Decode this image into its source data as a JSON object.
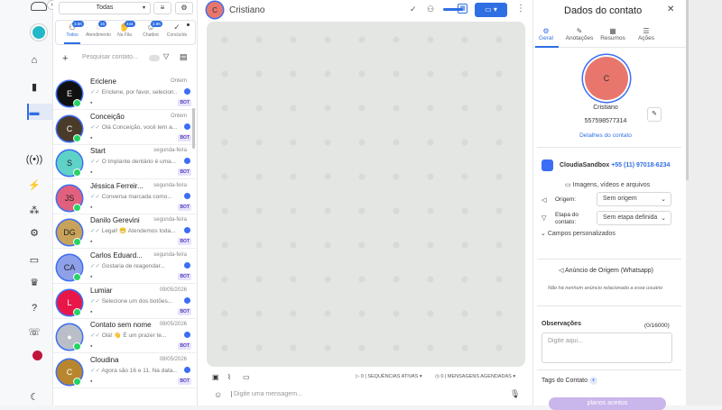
{
  "rail": {
    "items": [
      "home-icon",
      "chart-icon",
      "chat-icon",
      "broadcast-icon",
      "lightning-icon",
      "flow-icon",
      "gear-icon",
      "ticket-icon",
      "crown-icon",
      "help-icon",
      "support-icon",
      "record-icon",
      "moon-icon"
    ]
  },
  "list": {
    "filter_value": "Todas",
    "tabs": [
      {
        "label": "Todos",
        "badge": "3.5K"
      },
      {
        "label": "Atendimento",
        "badge": "16"
      },
      {
        "label": "Na Fila",
        "badge": "444"
      },
      {
        "label": "Chatbot",
        "badge": "2.8K"
      },
      {
        "label": "Concluído",
        "badge": ""
      }
    ],
    "search_placeholder": "Pesquisar contato...",
    "contacts": [
      {
        "initials": "E",
        "name": "Ericlene",
        "date": "Ontem",
        "msg": "Ericlene, por favor, selecion...",
        "color": "#111111",
        "text_color": "#ffffff",
        "bot": "BOT"
      },
      {
        "initials": "C",
        "name": "Conceição",
        "date": "Ontem",
        "msg": "Olá Conceição, você tem a...",
        "color": "#4a3a2a",
        "text_color": "#ffffff",
        "bot": "BOT"
      },
      {
        "initials": "S",
        "name": "Start",
        "date": "segunda-feira",
        "msg": "O Implante dentário é uma...",
        "color": "#5fd2c8",
        "text_color": "#222222",
        "bot": "BOT"
      },
      {
        "initials": "JS",
        "name": "Jéssica Ferreir...",
        "date": "segunda-feira",
        "msg": "Conversa marcada como...",
        "color": "#e0607e",
        "text_color": "#222222",
        "bot": "BOT"
      },
      {
        "initials": "DG",
        "name": "Danilo Gerevini",
        "date": "segunda-feira",
        "msg": "Legal! 😁 Atendemos toda...",
        "color": "#c9a25a",
        "text_color": "#222222",
        "bot": "BOT"
      },
      {
        "initials": "CA",
        "name": "Carlos Eduard...",
        "date": "segunda-feira",
        "msg": "Gostaria de reagendar...",
        "color": "#8ea0e8",
        "text_color": "#222222",
        "bot": "BOT"
      },
      {
        "initials": "L",
        "name": "Lumiar",
        "date": "09/05/2026",
        "msg": "Selecione um dos botões...",
        "color": "#e8174a",
        "text_color": "#ffffff",
        "bot": "BOT"
      },
      {
        "initials": "",
        "name": "Contato sem nome",
        "date": "08/05/2026",
        "msg": "Olá! 👋 É um prazer te...",
        "color": "#b9bec8",
        "text_color": "#ffffff",
        "bot": "BOT"
      },
      {
        "initials": "C",
        "name": "Cloudina",
        "date": "08/05/2026",
        "msg": "Agora são 16 e 11. Na data...",
        "color": "#b8862d",
        "text_color": "#ffffff",
        "bot": "BOT"
      }
    ]
  },
  "chat": {
    "contact_name": "Cristiano",
    "avatar_initial": "C",
    "sequences_count": "0",
    "sequences_label": "SEQUÊNCIAS ATIVAS",
    "scheduled_count": "0",
    "scheduled_label": "MENSAGENS AGENDADAS",
    "input_placeholder": "Digite uma mensagem..."
  },
  "panel": {
    "title": "Dados do contato",
    "tabs": [
      "Geral",
      "Anotações",
      "Resumos",
      "Ações"
    ],
    "avatar_initial": "C",
    "name": "Cristiano",
    "phone": "557598577314",
    "details_link": "Detalhes do contato",
    "channel_name": "CloudiaSandbox",
    "channel_phone": "+55 (11) 97018-6234",
    "media_label": "Imagens, vídeos e arquivos",
    "origin_label": "Origem:",
    "origin_value": "Sem origem",
    "stage_label": "Etapa do contato:",
    "stage_value": "Sem etapa definida",
    "custom_fields": "Campos personalizados",
    "ad_title": "Anúncio de Origem (Whatsapp)",
    "ad_empty": "Não há nenhum anúncio relacionado a esse usuário",
    "notes_label": "Observações",
    "notes_counter": "(0/16000)",
    "notes_placeholder": "Digite aqui...",
    "tags_label": "Tags do Contato",
    "tag_chip": "planos aceitos",
    "accent": "#2f6fe4",
    "avatar_color": "#e8766c"
  }
}
